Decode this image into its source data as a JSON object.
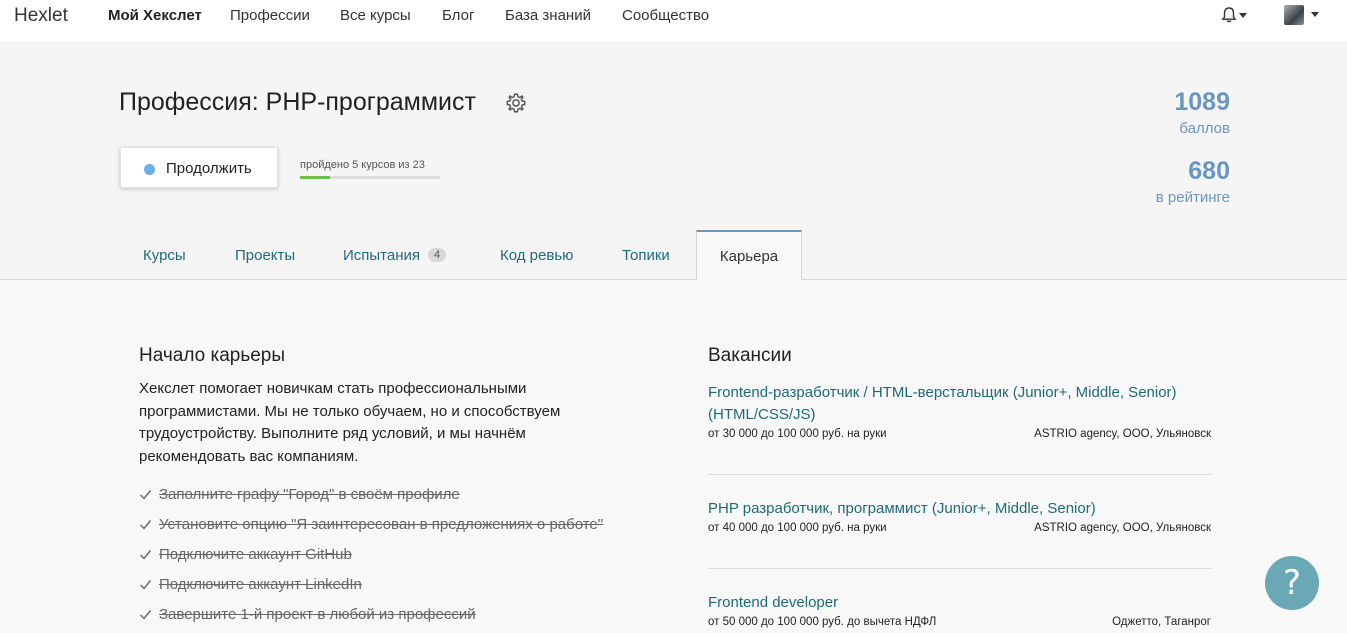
{
  "navbar": {
    "logo": "Hexlet",
    "links": [
      "Мой Хекслет",
      "Профессии",
      "Все курсы",
      "Блог",
      "База знаний",
      "Сообщество"
    ],
    "icons": [
      "bell-icon",
      "avatar"
    ]
  },
  "header": {
    "title": "Профессия: PHP-программист",
    "continue_label": "Продолжить",
    "progress_text": "пройдено 5 курсов из 23",
    "progress_fraction": 0.217,
    "points_value": "1089",
    "points_label": "баллов",
    "rating_value": "680",
    "rating_label": "в рейтинге"
  },
  "tabs": {
    "courses": "Курсы",
    "projects": "Проекты",
    "challenges": "Испытания",
    "challenges_count": "4",
    "code_review": "Код ревью",
    "topics": "Топики",
    "career": "Карьера"
  },
  "career": {
    "title": "Начало карьеры",
    "description": "Хекслет помогает новичкам стать профессиональными программистами. Мы не только обучаем, но и способствуем трудоустройству. Выполните ряд условий, и мы начнём рекомендовать вас компаниям.",
    "checklist": [
      "Заполните графу \"Город\" в своём профиле",
      "Установите опцию \"Я заинтересован в предложениях о работе\"",
      "Подключите аккаунт GitHub",
      "Подключите аккаунт LinkedIn",
      "Завершите 1-й проект в любой из профессий"
    ]
  },
  "vacancies": {
    "title": "Вакансии",
    "items": [
      {
        "title": "Frontend-разработчик / HTML-верстальщик (Junior+, Middle, Senior) (HTML/CSS/JS)",
        "salary": "от 30 000 до 100 000 руб. на руки",
        "company": "ASTRIO agency, ООО, Ульяновск"
      },
      {
        "title": "PHP разработчик, программист (Junior+, Middle, Senior)",
        "salary": "от 40 000 до 100 000 руб. на руки",
        "company": "ASTRIO agency, ООО, Ульяновск"
      },
      {
        "title": "Frontend developer",
        "salary": "от 50 000 до 100 000 руб. до вычета НДФЛ",
        "company": "Оджетто, Таганрог"
      }
    ]
  },
  "help": {
    "label": "?"
  },
  "colors": {
    "accent": "#6a96bf",
    "link": "#1f6a78",
    "progress": "#6cbf4a",
    "help": "#6aa8b5"
  }
}
